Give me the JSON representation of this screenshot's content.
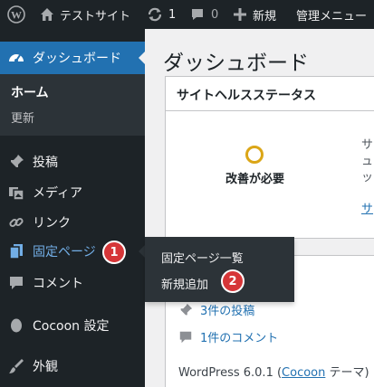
{
  "adminbar": {
    "site_name": "テストサイト",
    "updates_count": "1",
    "comments_count": "0",
    "new_label": "新規",
    "admin_menu_label": "管理メニュー"
  },
  "sidebar": {
    "dashboard_label": "ダッシュボード",
    "home_label": "ホーム",
    "update_label": "更新",
    "items": [
      {
        "label": "投稿",
        "icon": "pin-icon"
      },
      {
        "label": "メディア",
        "icon": "media-icon"
      },
      {
        "label": "リンク",
        "icon": "link-icon"
      },
      {
        "label": "固定ページ",
        "icon": "page-icon"
      },
      {
        "label": "コメント",
        "icon": "comment-icon"
      },
      {
        "label": "Cocoon 設定",
        "icon": "cocoon-icon"
      },
      {
        "label": "外観",
        "icon": "brush-icon"
      }
    ]
  },
  "flyout": {
    "all_pages_label": "固定ページ一覧",
    "add_new_label": "新規追加"
  },
  "badges": {
    "step1": "1",
    "step2": "2"
  },
  "main": {
    "page_title": "ダッシュボード",
    "health_panel": {
      "title": "サイトヘルスステータス",
      "status": "改善が必要",
      "cut_line1": "サ",
      "cut_line2": "ュ",
      "cut_line3": "ッ",
      "cut_link": "サ"
    },
    "glance": {
      "posts": "3件の投稿",
      "comments": "1件のコメント",
      "version_prefix": "WordPress 6.0.1 (",
      "theme_link": "Cocoon",
      "version_suffix": " テーマ)"
    }
  },
  "colors": {
    "adminbar_bg": "#1d2327",
    "accent": "#2271b1",
    "badge": "#d63638",
    "health_warning": "#dba617"
  }
}
